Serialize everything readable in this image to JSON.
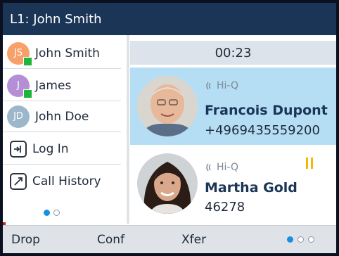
{
  "header": {
    "line_title": "L1: John Smith"
  },
  "sidebar": {
    "items": [
      {
        "initials": "JS",
        "label": "John Smith",
        "avatar_color": "#f7a06a",
        "presence": "available"
      },
      {
        "initials": "J",
        "label": "James",
        "avatar_color": "#b48fd6",
        "presence": "available"
      },
      {
        "initials": "JD",
        "label": "John Doe",
        "avatar_color": "#9bb7c9",
        "presence": "none"
      },
      {
        "icon": "login-icon",
        "label": "Log In"
      },
      {
        "icon": "call-history-icon",
        "label": "Call History"
      }
    ],
    "page_indicator": {
      "pages": 2,
      "current": 1
    }
  },
  "call_area": {
    "timer": "00:23",
    "calls": [
      {
        "badge": "Hi-Q",
        "name": "Francois Dupont",
        "number": "+4969435559200",
        "state": "active"
      },
      {
        "badge": "Hi-Q",
        "name": "Martha Gold",
        "number": "46278",
        "state": "held"
      }
    ]
  },
  "softkeys": {
    "labels": [
      "Drop",
      "Conf",
      "Xfer"
    ],
    "page_indicator": {
      "pages": 3,
      "current": 1
    }
  },
  "colors": {
    "header_bg": "#1b3557",
    "active_call_bg": "#b5def5",
    "presence_available": "#1fb53b",
    "hold_icon": "#f3b800",
    "page_dot_active": "#1a8fe0"
  }
}
